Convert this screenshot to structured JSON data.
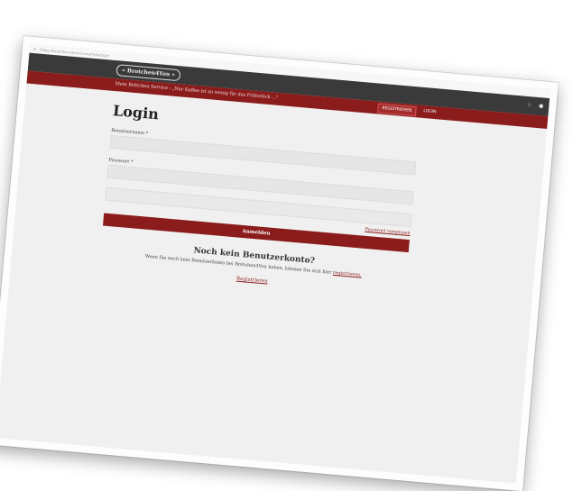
{
  "browser": {
    "url": "https://brotchen-service.example/login"
  },
  "header": {
    "logo": "« Brotchen4You »",
    "tagline": "Mein Brötchen Service - „Nur Kaffee ist zu wenig für das Frühstück ...\"",
    "nav": {
      "register": "REGISTRIEREN",
      "login": "LOGIN"
    }
  },
  "form": {
    "title": "Login",
    "username_label": "Benutzername *",
    "password_label": "Passwort *",
    "forgot": "Passwort vergessen",
    "submit": "Anmelden"
  },
  "signup": {
    "title": "Noch kein Benutzerkonto?",
    "text": "Wenn Sie noch kein Benutzerkonto bei Brotchen4You haben, können Sie sich hier",
    "link": "registrieren.",
    "cta": "Registrieren"
  }
}
